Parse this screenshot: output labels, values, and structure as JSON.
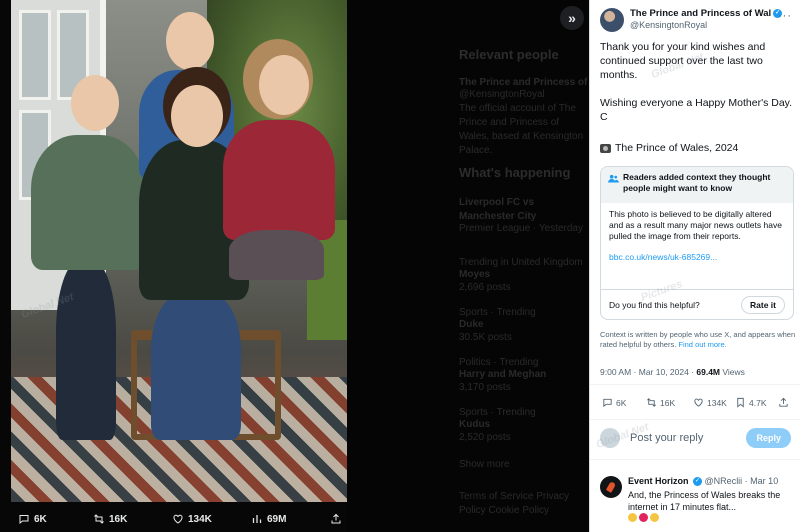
{
  "viewer": {
    "expand_label": "»",
    "actions": {
      "replies": "6K",
      "reposts": "16K",
      "likes": "134K",
      "views": "69M"
    },
    "background_feed": {
      "relevant_heading": "Relevant people",
      "relevant_name": "The Prince and Princess of",
      "relevant_handle": "@KensingtonRoyal",
      "relevant_bio": "The official account of The Prince and Princess of Wales, based at Kensington Palace.",
      "happening_heading": "What's happening",
      "trend_1": "Liverpool FC vs Manchester City",
      "trend_1_meta": "Premier League · Yesterday",
      "trend_2_meta": "Trending in United Kingdom",
      "trend_2": "Moyes",
      "trend_2_posts": "2,696 posts",
      "trend_3_meta": "Sports · Trending",
      "trend_3": "Duke",
      "trend_3_posts": "30.5K posts",
      "trend_4_meta": "Politics · Trending",
      "trend_4": "Harry and Meghan",
      "trend_4_posts": "3,170 posts",
      "trend_5_meta": "Sports · Trending",
      "trend_5": "Kudus",
      "trend_5_posts": "2,520 posts",
      "show_more": "Show more",
      "footer": "Terms of Service  Privacy Policy  Cookie Policy"
    }
  },
  "tweet": {
    "author_name": "The Prince and Princess of Wal",
    "author_handle": "@KensingtonRoyal",
    "more_label": "···",
    "paragraph_1": "Thank you for your kind wishes and continued support over the last two months.",
    "paragraph_2": "Wishing everyone a Happy Mother's Day. C",
    "credit": "The Prince of Wales, 2024",
    "note": {
      "heading": "Readers added context they thought people might want to know",
      "body": "This photo is believed to be digitally altered and as a result many major news outlets have pulled the image from their reports.",
      "link": "bbc.co.uk/news/uk-685269...",
      "question": "Do you find this helpful?",
      "rate_label": "Rate it"
    },
    "context_text": "Context is written by people who use X, and appears when rated helpful by others.",
    "context_link": "Find out more.",
    "timestamp": "9:00 AM · Mar 10, 2024 · ",
    "views_count": "69.4M",
    "views_label": " Views",
    "stats": {
      "replies": "6K",
      "reposts": "16K",
      "likes": "134K",
      "bookmarks": "4.7K"
    },
    "reply_placeholder": "Post your reply",
    "reply_button": "Reply"
  },
  "reply": {
    "name": "Event Horizon",
    "handle": "@NReclii · Mar 10",
    "text": "And, the Princess of Wales breaks the internet in 17 minutes flat..."
  },
  "watermark": {
    "line1": "Global Net",
    "line2": "Pictures"
  },
  "colors": {
    "accent": "#1d9bf0",
    "reply_button_bg": "#8ecdf8",
    "panel_bg": "#ffffff",
    "viewer_bg": "#000000"
  }
}
